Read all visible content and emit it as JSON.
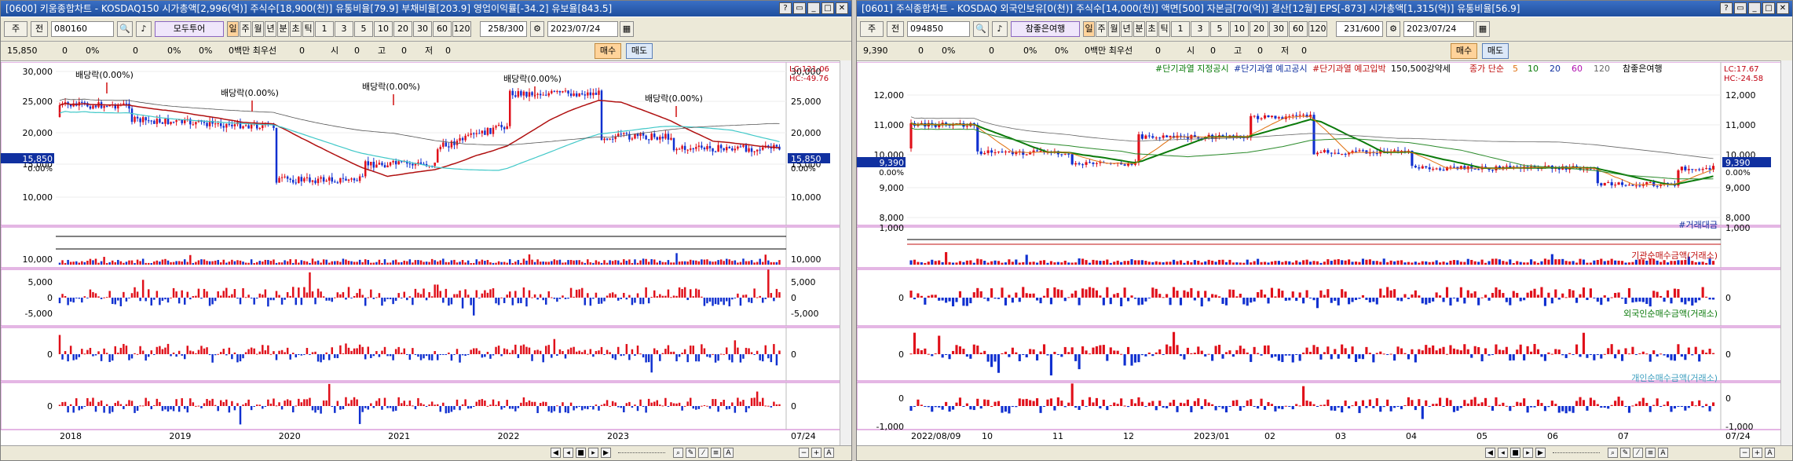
{
  "left": {
    "title": "[0600] 키움종합차트 - KOSDAQ150 시가총액[2,996(억)] 주식수[18,900(천)] 유통비율[79.9] 부채비율[203.9] 영업이익률[-34.2] 유보율[843.5]",
    "toolbar": {
      "market": "주",
      "prev": "전",
      "code": "080160",
      "broker": "모두투어",
      "periods": [
        "일",
        "주",
        "월",
        "년",
        "분",
        "초",
        "틱"
      ],
      "nums": [
        "1",
        "3",
        "5",
        "10",
        "20",
        "30",
        "60",
        "120"
      ],
      "count": "258/300",
      "date": "2023/07/24"
    },
    "quote": {
      "values": [
        "15,850",
        "0",
        "0%",
        "0",
        "0%",
        "0%",
        "0백만 최우선",
        "0",
        "시",
        "0",
        "고",
        "0",
        "저",
        "0"
      ],
      "buy": "매수",
      "sell": "매도"
    },
    "price_axis": [
      "30,000",
      "25,000",
      "20,000",
      "15,000",
      "10,000"
    ],
    "price_current": "15,850",
    "pct_current": "0.00%",
    "lc": "LC:121.06",
    "hc": "HC:-49.76",
    "dividend_labels": [
      "배당락(0.00%)",
      "배당락(0.00%)",
      "배당락(0.00%)",
      "배당락(0.00%)",
      "배당락(0.00%)"
    ],
    "vol_axis": "10,000",
    "p1_axis": [
      "5,000",
      "0",
      "-5,000"
    ],
    "p2_axis": "0",
    "p3_axis": "0",
    "x_labels": [
      "2018",
      "2019",
      "2020",
      "2021",
      "2022",
      "2023"
    ],
    "x_end": "07/24"
  },
  "right": {
    "title": "[0601] 주식종합차트 - KOSDAQ 외국인보유[0(천)] 주식수[14,000(천)] 액면[500] 자본금[70(억)] 결산[12월] EPS[-873] 시가총액[1,315(억)] 유통비율[56.9]",
    "toolbar": {
      "market": "주",
      "prev": "전",
      "code": "094850",
      "broker": "참좋은여행",
      "periods": [
        "일",
        "주",
        "월",
        "년",
        "분",
        "초",
        "틱"
      ],
      "nums": [
        "1",
        "3",
        "5",
        "10",
        "20",
        "30",
        "60",
        "120"
      ],
      "count": "231/600",
      "date": "2023/07/24"
    },
    "quote": {
      "values": [
        "9,390",
        "0",
        "0%",
        "0",
        "0%",
        "0%",
        "0백만 최우선",
        "0",
        "시",
        "0",
        "고",
        "0",
        "저",
        "0"
      ],
      "buy": "매수",
      "sell": "매도"
    },
    "legend": [
      "#단기과열 지정공시",
      "#단기과열 예고공시",
      "#단기과열 예고입박",
      "150,500강약세",
      "종가 단순",
      "5",
      "10",
      "20",
      "60",
      "120",
      "참좋은여행"
    ],
    "price_axis": [
      "12,000",
      "11,000",
      "10,000",
      "9,000",
      "8,000"
    ],
    "price_current": "9,390",
    "pct_current": "0.00%",
    "lc": "LC:17.67",
    "hc": "HC:-24.58",
    "vol_axis": "1,000",
    "vol_label": "#거래대금",
    "p1_label": "기관순매수금액(거래소)",
    "p2_label": "외국인순매수금액(거래소)",
    "p3_label": "개인순매수금액(거래소)",
    "p1_axis": "0",
    "p2_axis": "0",
    "p3_axis": [
      "0",
      "-1,000"
    ],
    "x_labels": [
      "2022/08/09",
      "10",
      "11",
      "12",
      "2023/01",
      "02",
      "03",
      "04",
      "05",
      "06",
      "07"
    ],
    "x_end": "07/24"
  },
  "colors": {
    "up": "#e0101a",
    "down": "#1030d0",
    "ma_green": "#0a7a0a",
    "ma_cyan": "#40c8c8",
    "ma_darkred": "#b01010",
    "panel_border": "#c86ec8"
  }
}
